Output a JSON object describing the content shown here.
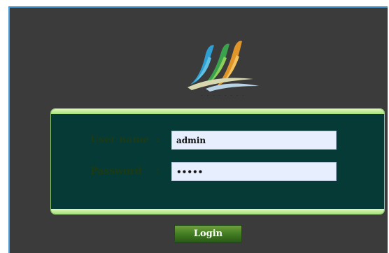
{
  "logo": {
    "caption": "· · · · ·  · · ·"
  },
  "form": {
    "username_label": "User name",
    "username_sep": ":",
    "username_value": "admin",
    "password_label": "Password",
    "password_sep": ":",
    "password_value": "•••••"
  },
  "actions": {
    "login_label": "Login"
  },
  "colors": {
    "frame_bg": "#3b3b3b",
    "panel_bg": "#063a37",
    "panel_band": "#a6e37a",
    "button_bg": "#3f7a22",
    "input_bg": "#e7efff"
  }
}
